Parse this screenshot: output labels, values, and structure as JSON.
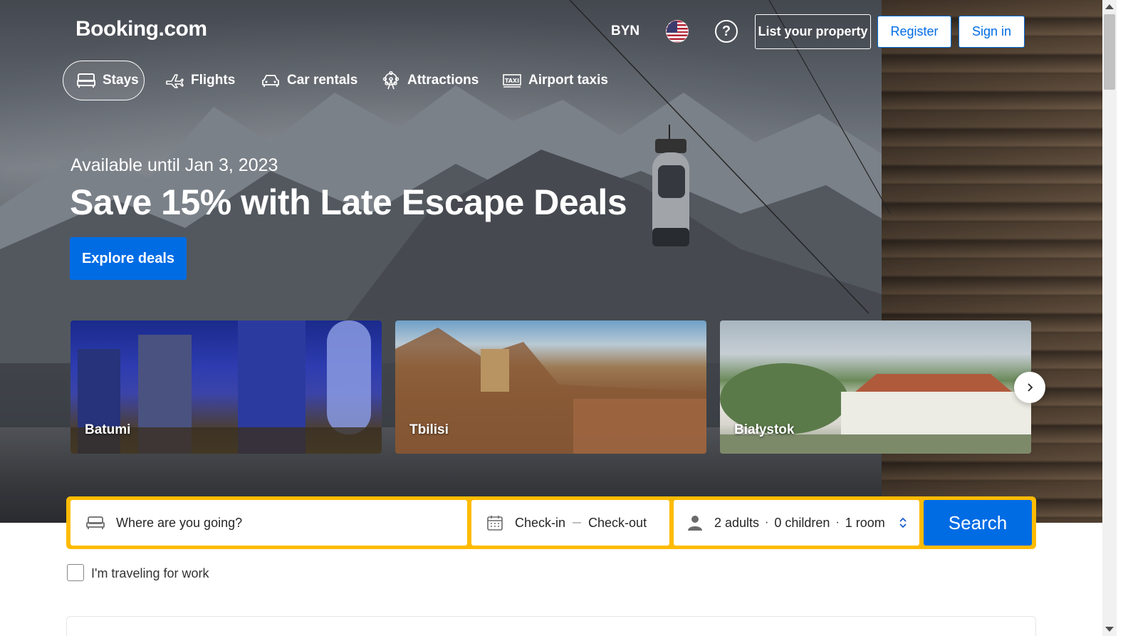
{
  "header": {
    "logo": "Booking.com",
    "currency": "BYN",
    "help_label": "?",
    "list_property": "List your property",
    "register": "Register",
    "sign_in": "Sign in"
  },
  "nav": {
    "tabs": [
      {
        "label": "Stays",
        "icon": "bed-icon",
        "active": true
      },
      {
        "label": "Flights",
        "icon": "plane-icon",
        "active": false
      },
      {
        "label": "Car rentals",
        "icon": "car-icon",
        "active": false
      },
      {
        "label": "Attractions",
        "icon": "ferris-wheel-icon",
        "active": false
      },
      {
        "label": "Airport taxis",
        "icon": "taxi-icon",
        "active": false
      }
    ]
  },
  "promo": {
    "subtitle": "Available until Jan 3, 2023",
    "title": "Save 15% with Late Escape Deals",
    "cta": "Explore deals"
  },
  "destinations": [
    {
      "name": "Batumi"
    },
    {
      "name": "Tbilisi"
    },
    {
      "name": "Białystok"
    }
  ],
  "search": {
    "destination_placeholder": "Where are you going?",
    "check_in": "Check-in",
    "check_out": "Check-out",
    "adults": "2 adults",
    "children": "0 children",
    "rooms": "1 room",
    "separator": "·",
    "button": "Search"
  },
  "work_travel": {
    "label": "I'm traveling for work",
    "checked": false
  },
  "colors": {
    "brand_blue": "#006ce4",
    "search_border": "#febb02"
  }
}
